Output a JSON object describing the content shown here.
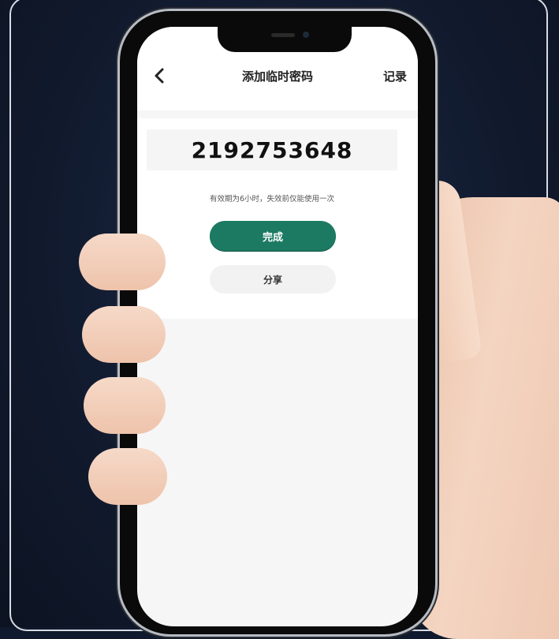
{
  "nav": {
    "title": "添加临时密码",
    "record_label": "记录"
  },
  "password": {
    "value": "2192753648",
    "hint": "有效期为6小时，失效前仅能使用一次"
  },
  "actions": {
    "done_label": "完成",
    "share_label": "分享"
  },
  "colors": {
    "accent": "#1c7a62",
    "background": "#101a2e"
  },
  "icons": {
    "back": "chevron-left-icon"
  }
}
